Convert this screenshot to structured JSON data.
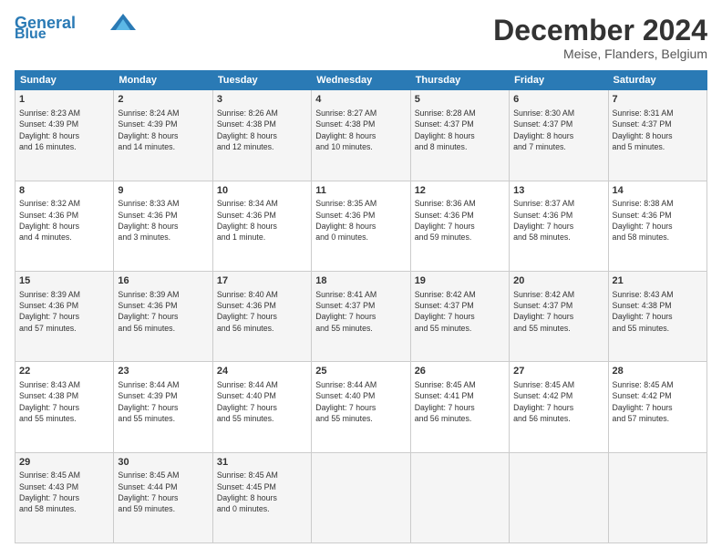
{
  "header": {
    "logo_line1": "General",
    "logo_line2": "Blue",
    "month": "December 2024",
    "location": "Meise, Flanders, Belgium"
  },
  "days": [
    "Sunday",
    "Monday",
    "Tuesday",
    "Wednesday",
    "Thursday",
    "Friday",
    "Saturday"
  ],
  "weeks": [
    [
      {
        "num": "1",
        "info": "Sunrise: 8:23 AM\nSunset: 4:39 PM\nDaylight: 8 hours\nand 16 minutes."
      },
      {
        "num": "2",
        "info": "Sunrise: 8:24 AM\nSunset: 4:39 PM\nDaylight: 8 hours\nand 14 minutes."
      },
      {
        "num": "3",
        "info": "Sunrise: 8:26 AM\nSunset: 4:38 PM\nDaylight: 8 hours\nand 12 minutes."
      },
      {
        "num": "4",
        "info": "Sunrise: 8:27 AM\nSunset: 4:38 PM\nDaylight: 8 hours\nand 10 minutes."
      },
      {
        "num": "5",
        "info": "Sunrise: 8:28 AM\nSunset: 4:37 PM\nDaylight: 8 hours\nand 8 minutes."
      },
      {
        "num": "6",
        "info": "Sunrise: 8:30 AM\nSunset: 4:37 PM\nDaylight: 8 hours\nand 7 minutes."
      },
      {
        "num": "7",
        "info": "Sunrise: 8:31 AM\nSunset: 4:37 PM\nDaylight: 8 hours\nand 5 minutes."
      }
    ],
    [
      {
        "num": "8",
        "info": "Sunrise: 8:32 AM\nSunset: 4:36 PM\nDaylight: 8 hours\nand 4 minutes."
      },
      {
        "num": "9",
        "info": "Sunrise: 8:33 AM\nSunset: 4:36 PM\nDaylight: 8 hours\nand 3 minutes."
      },
      {
        "num": "10",
        "info": "Sunrise: 8:34 AM\nSunset: 4:36 PM\nDaylight: 8 hours\nand 1 minute."
      },
      {
        "num": "11",
        "info": "Sunrise: 8:35 AM\nSunset: 4:36 PM\nDaylight: 8 hours\nand 0 minutes."
      },
      {
        "num": "12",
        "info": "Sunrise: 8:36 AM\nSunset: 4:36 PM\nDaylight: 7 hours\nand 59 minutes."
      },
      {
        "num": "13",
        "info": "Sunrise: 8:37 AM\nSunset: 4:36 PM\nDaylight: 7 hours\nand 58 minutes."
      },
      {
        "num": "14",
        "info": "Sunrise: 8:38 AM\nSunset: 4:36 PM\nDaylight: 7 hours\nand 58 minutes."
      }
    ],
    [
      {
        "num": "15",
        "info": "Sunrise: 8:39 AM\nSunset: 4:36 PM\nDaylight: 7 hours\nand 57 minutes."
      },
      {
        "num": "16",
        "info": "Sunrise: 8:39 AM\nSunset: 4:36 PM\nDaylight: 7 hours\nand 56 minutes."
      },
      {
        "num": "17",
        "info": "Sunrise: 8:40 AM\nSunset: 4:36 PM\nDaylight: 7 hours\nand 56 minutes."
      },
      {
        "num": "18",
        "info": "Sunrise: 8:41 AM\nSunset: 4:37 PM\nDaylight: 7 hours\nand 55 minutes."
      },
      {
        "num": "19",
        "info": "Sunrise: 8:42 AM\nSunset: 4:37 PM\nDaylight: 7 hours\nand 55 minutes."
      },
      {
        "num": "20",
        "info": "Sunrise: 8:42 AM\nSunset: 4:37 PM\nDaylight: 7 hours\nand 55 minutes."
      },
      {
        "num": "21",
        "info": "Sunrise: 8:43 AM\nSunset: 4:38 PM\nDaylight: 7 hours\nand 55 minutes."
      }
    ],
    [
      {
        "num": "22",
        "info": "Sunrise: 8:43 AM\nSunset: 4:38 PM\nDaylight: 7 hours\nand 55 minutes."
      },
      {
        "num": "23",
        "info": "Sunrise: 8:44 AM\nSunset: 4:39 PM\nDaylight: 7 hours\nand 55 minutes."
      },
      {
        "num": "24",
        "info": "Sunrise: 8:44 AM\nSunset: 4:40 PM\nDaylight: 7 hours\nand 55 minutes."
      },
      {
        "num": "25",
        "info": "Sunrise: 8:44 AM\nSunset: 4:40 PM\nDaylight: 7 hours\nand 55 minutes."
      },
      {
        "num": "26",
        "info": "Sunrise: 8:45 AM\nSunset: 4:41 PM\nDaylight: 7 hours\nand 56 minutes."
      },
      {
        "num": "27",
        "info": "Sunrise: 8:45 AM\nSunset: 4:42 PM\nDaylight: 7 hours\nand 56 minutes."
      },
      {
        "num": "28",
        "info": "Sunrise: 8:45 AM\nSunset: 4:42 PM\nDaylight: 7 hours\nand 57 minutes."
      }
    ],
    [
      {
        "num": "29",
        "info": "Sunrise: 8:45 AM\nSunset: 4:43 PM\nDaylight: 7 hours\nand 58 minutes."
      },
      {
        "num": "30",
        "info": "Sunrise: 8:45 AM\nSunset: 4:44 PM\nDaylight: 7 hours\nand 59 minutes."
      },
      {
        "num": "31",
        "info": "Sunrise: 8:45 AM\nSunset: 4:45 PM\nDaylight: 8 hours\nand 0 minutes."
      },
      null,
      null,
      null,
      null
    ]
  ]
}
